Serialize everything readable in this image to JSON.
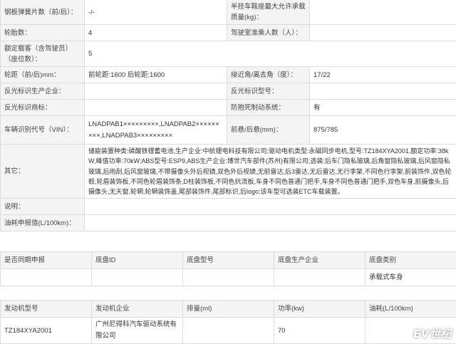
{
  "spec": {
    "r1": {
      "l1": "钢板弹簧片数（前/后）：",
      "v1": "-/-",
      "l2": "半挂车鞍座最大允许承载质量(kg)：",
      "v2": ""
    },
    "r2": {
      "l1": "轮胎数：",
      "v1": "4",
      "l2": "驾驶室准乘人数（人）：",
      "v2": ""
    },
    "r3": {
      "l1": "额定载客（含驾驶员）（座位数）：",
      "v1": "5"
    },
    "r4": {
      "l1": "轮距（前/后)mm：",
      "v1": "前轮距:1600 后轮距:1600",
      "l2": "接近角/离去角（度）：",
      "v2": "17/22"
    },
    "r5": {
      "l1": "反光标识生产企业：",
      "v1": "",
      "l2": "反光标识型号：",
      "v2": ""
    },
    "r6": {
      "l1": "反光标识商标：",
      "v1": "",
      "l2": "防抱死制动系统：",
      "v2": "有"
    },
    "r7": {
      "l1": "车辆识别代号（VIN）：",
      "v1": "LNADPAB1×××××××××,LNADPAB2×××××××××,LNADPAB3×××××××××",
      "l2": "前悬/后悬(mm)：",
      "v2": "875/785"
    },
    "r8": {
      "l1": "其它：",
      "v1": "储能装置种类:磷酸铁锂蓄电池,生产企业:中航锂电科技有限公司;驱动电机类型:永磁同步电机,型号:TZ184XYA2001,额定功率:38kW,峰值功率:70kW;ABS型号:ESP9,ABS生产企业:博世汽车部件(苏州)有限公司;选装:后车门隐私玻璃,后角窗隐私玻璃,后风窗隐私玻璃,后雨刮,后风窗玻璃,不带摄像头外后视镜,双色外后视镜,无前雷达,后3雷达,无后雷达,无行李架,不同色行李架,前装饰件,双色轮毂,轮眉装饰板,不同色轮眉装饰条,D柱装饰板,不同色抗流板,车身不同色普通门把手,车身不同色普通门把手,双色车身,前摄像头,后摄像头,无天窗,轮辋,轮辋装饰盖,尾部装饰件,尾部标识,后logo;该车型可选装ETC车载装置。"
    },
    "r9": {
      "l1": "说明："
    },
    "r10": {
      "l1": "油耗申报值(L/100km)："
    }
  },
  "chassis": {
    "headers": [
      "是否同期申报",
      "底盘ID",
      "底盘型号",
      "底盘生产企业",
      "底盘类别"
    ],
    "row": [
      "",
      "",
      "",
      "",
      "承载式车身"
    ]
  },
  "engine": {
    "headers": [
      "发动机型号",
      "发动机企业",
      "排量(ml)",
      "功率(kw)",
      "油耗(L/100km)"
    ],
    "row": [
      "TZ184XYA2001",
      "广州尼得科汽车驱动系统有限公司",
      "",
      "70",
      ""
    ]
  },
  "watermark": "EV世纪"
}
